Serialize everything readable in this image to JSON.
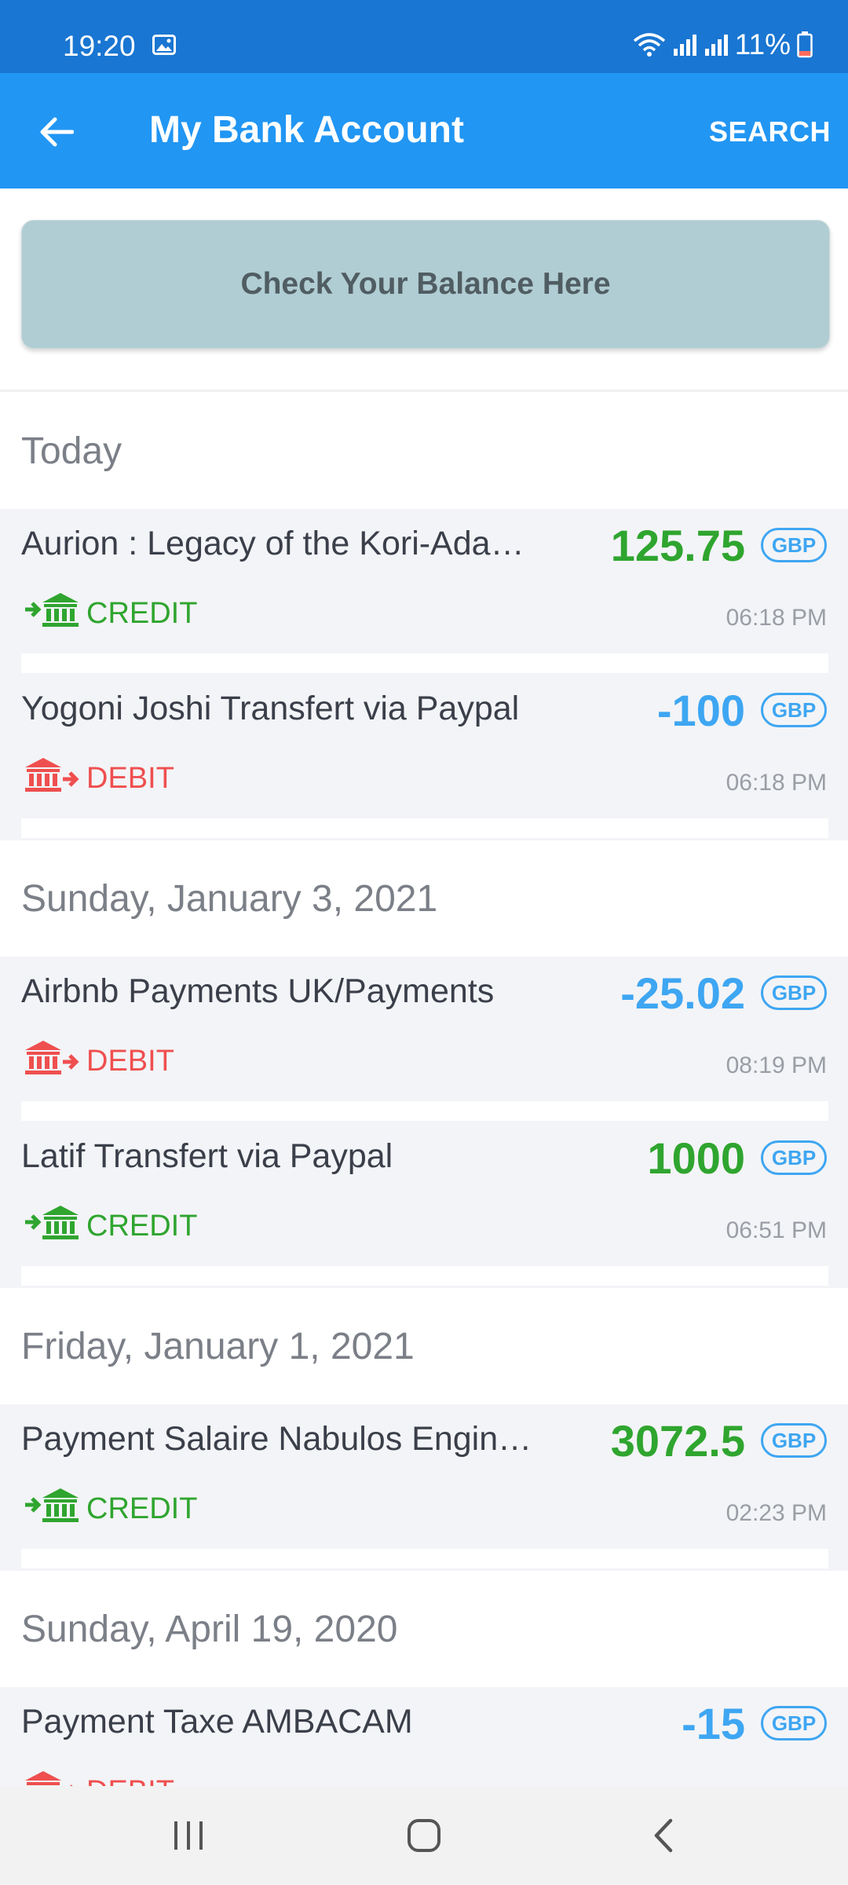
{
  "status_bar": {
    "time": "19:20",
    "battery": "11%"
  },
  "app_bar": {
    "title": "My Bank Account",
    "search_label": "SEARCH"
  },
  "balance_button": {
    "label": "Check Your Balance Here"
  },
  "sections": [
    {
      "date": "Today",
      "transactions": [
        {
          "description": "Aurion : Legacy of the Kori-Ada…",
          "amount": "125.75",
          "currency": "GBP",
          "type": "CREDIT",
          "time": "06:18 PM"
        },
        {
          "description": "Yogoni Joshi Transfert via Paypal",
          "amount": "-100",
          "currency": "GBP",
          "type": "DEBIT",
          "time": "06:18 PM"
        }
      ]
    },
    {
      "date": "Sunday, January 3, 2021",
      "transactions": [
        {
          "description": "Airbnb Payments UK/Payments",
          "amount": "-25.02",
          "currency": "GBP",
          "type": "DEBIT",
          "time": "08:19 PM"
        },
        {
          "description": "Latif Transfert via Paypal",
          "amount": "1000",
          "currency": "GBP",
          "type": "CREDIT",
          "time": "06:51 PM"
        }
      ]
    },
    {
      "date": "Friday, January 1, 2021",
      "transactions": [
        {
          "description": "Payment Salaire Nabulos Engin…",
          "amount": "3072.5",
          "currency": "GBP",
          "type": "CREDIT",
          "time": "02:23 PM"
        }
      ]
    },
    {
      "date": "Sunday, April 19, 2020",
      "transactions": [
        {
          "description": "Payment Taxe AMBACAM",
          "amount": "-15",
          "currency": "GBP",
          "type": "DEBIT",
          "time": ""
        }
      ]
    }
  ],
  "colors": {
    "credit": "#2fa52f",
    "debit_amount": "#3ea6f2",
    "debit_type": "#ef4f4f",
    "app_bar": "#2196f3",
    "status_bar": "#1976d2"
  },
  "icons": {
    "credit": "bank-credit-icon",
    "debit": "bank-debit-icon"
  }
}
